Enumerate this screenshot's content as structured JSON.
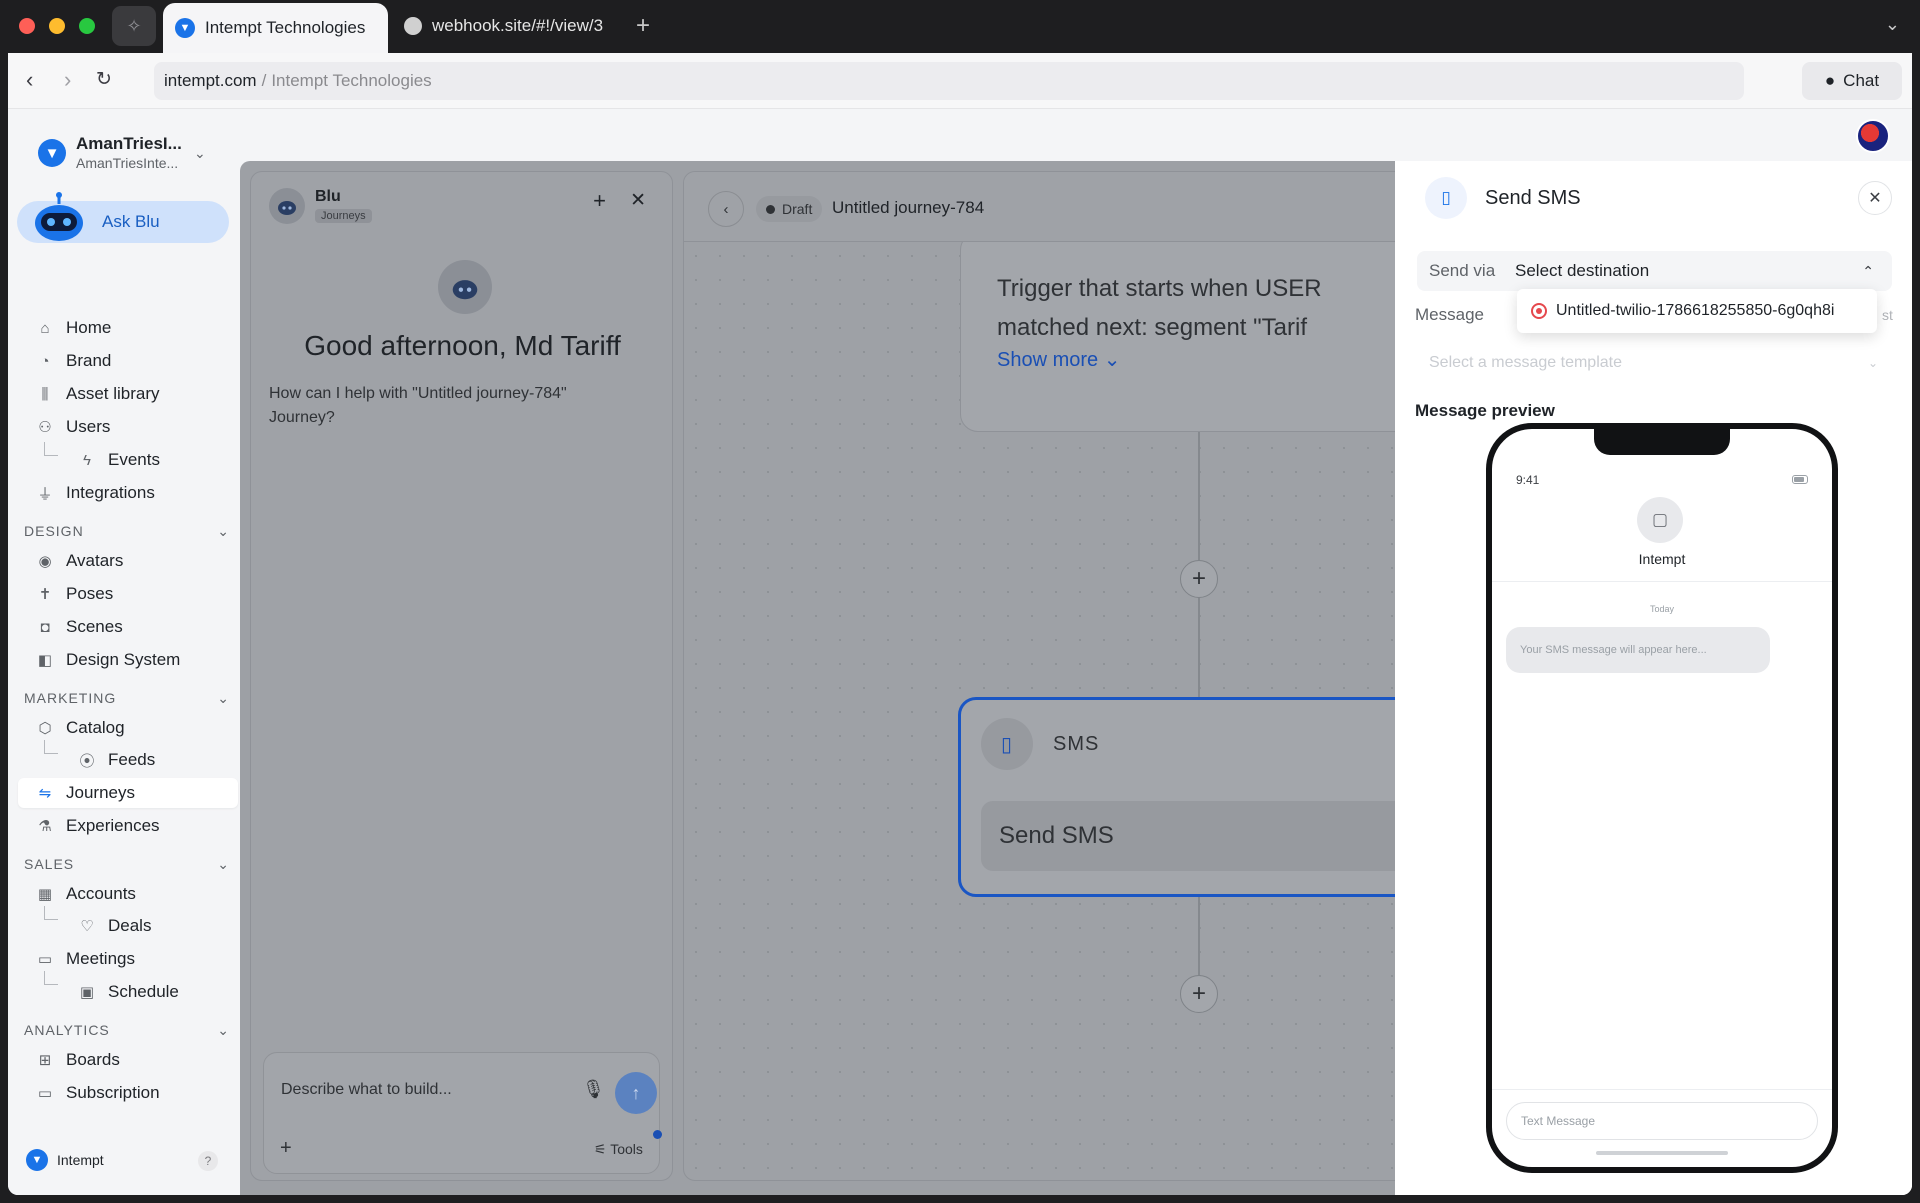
{
  "browser": {
    "tabs": [
      {
        "title": "Intempt Technologies",
        "active": true
      },
      {
        "title": "webhook.site/#!/view/3",
        "active": false
      }
    ],
    "url_domain": "intempt.com",
    "url_sep": "/",
    "url_page": "Intempt Technologies",
    "chat_label": "Chat"
  },
  "sidebar": {
    "org_name": "AmanTriesI...",
    "org_sub": "AmanTriesInte...",
    "ask_blu": "Ask Blu",
    "items": {
      "home": "Home",
      "brand": "Brand",
      "asset_library": "Asset library",
      "users": "Users",
      "events": "Events",
      "integrations": "Integrations",
      "avatars": "Avatars",
      "poses": "Poses",
      "scenes": "Scenes",
      "design_system": "Design System",
      "catalog": "Catalog",
      "feeds": "Feeds",
      "journeys": "Journeys",
      "experiences": "Experiences",
      "accounts": "Accounts",
      "deals": "Deals",
      "meetings": "Meetings",
      "schedule": "Schedule",
      "boards": "Boards",
      "subscription": "Subscription"
    },
    "sections": {
      "design": "DESIGN",
      "marketing": "MARKETING",
      "sales": "SALES",
      "analytics": "ANALYTICS"
    },
    "footer": "Intempt",
    "help": "?"
  },
  "blu_panel": {
    "title": "Blu",
    "badge": "Journeys",
    "greeting": "Good afternoon, Md Tariff",
    "help_text": "How can I help with \"Untitled journey-784\" Journey?",
    "composer_placeholder": "Describe what to build...",
    "tools_label": "Tools"
  },
  "canvas": {
    "status": "Draft",
    "journey_title": "Untitled journey-784",
    "trigger_line1": "Trigger that starts when USER",
    "trigger_line2": "matched next: segment \"Tarif",
    "show_more": "Show more",
    "sms_node_type": "SMS",
    "sms_node_body": "Send SMS"
  },
  "send_sms_panel": {
    "title": "Send SMS",
    "send_via_label": "Send via",
    "send_via_value": "Select destination",
    "dropdown_option": "Untitled-twilio-1786618255850-6g0qh8i",
    "message_label": "Message",
    "message_right_fragment": "st",
    "template_placeholder": "Select a message template",
    "preview_label": "Message preview",
    "phone": {
      "time": "9:41",
      "contact": "Intempt",
      "day": "Today",
      "bubble": "Your SMS message will appear here...",
      "input_placeholder": "Text Message"
    }
  },
  "colors": {
    "accent": "#1a73e8",
    "sms_node_border": "#1a56c4",
    "ask_blu_bg": "#cfe1fb"
  }
}
